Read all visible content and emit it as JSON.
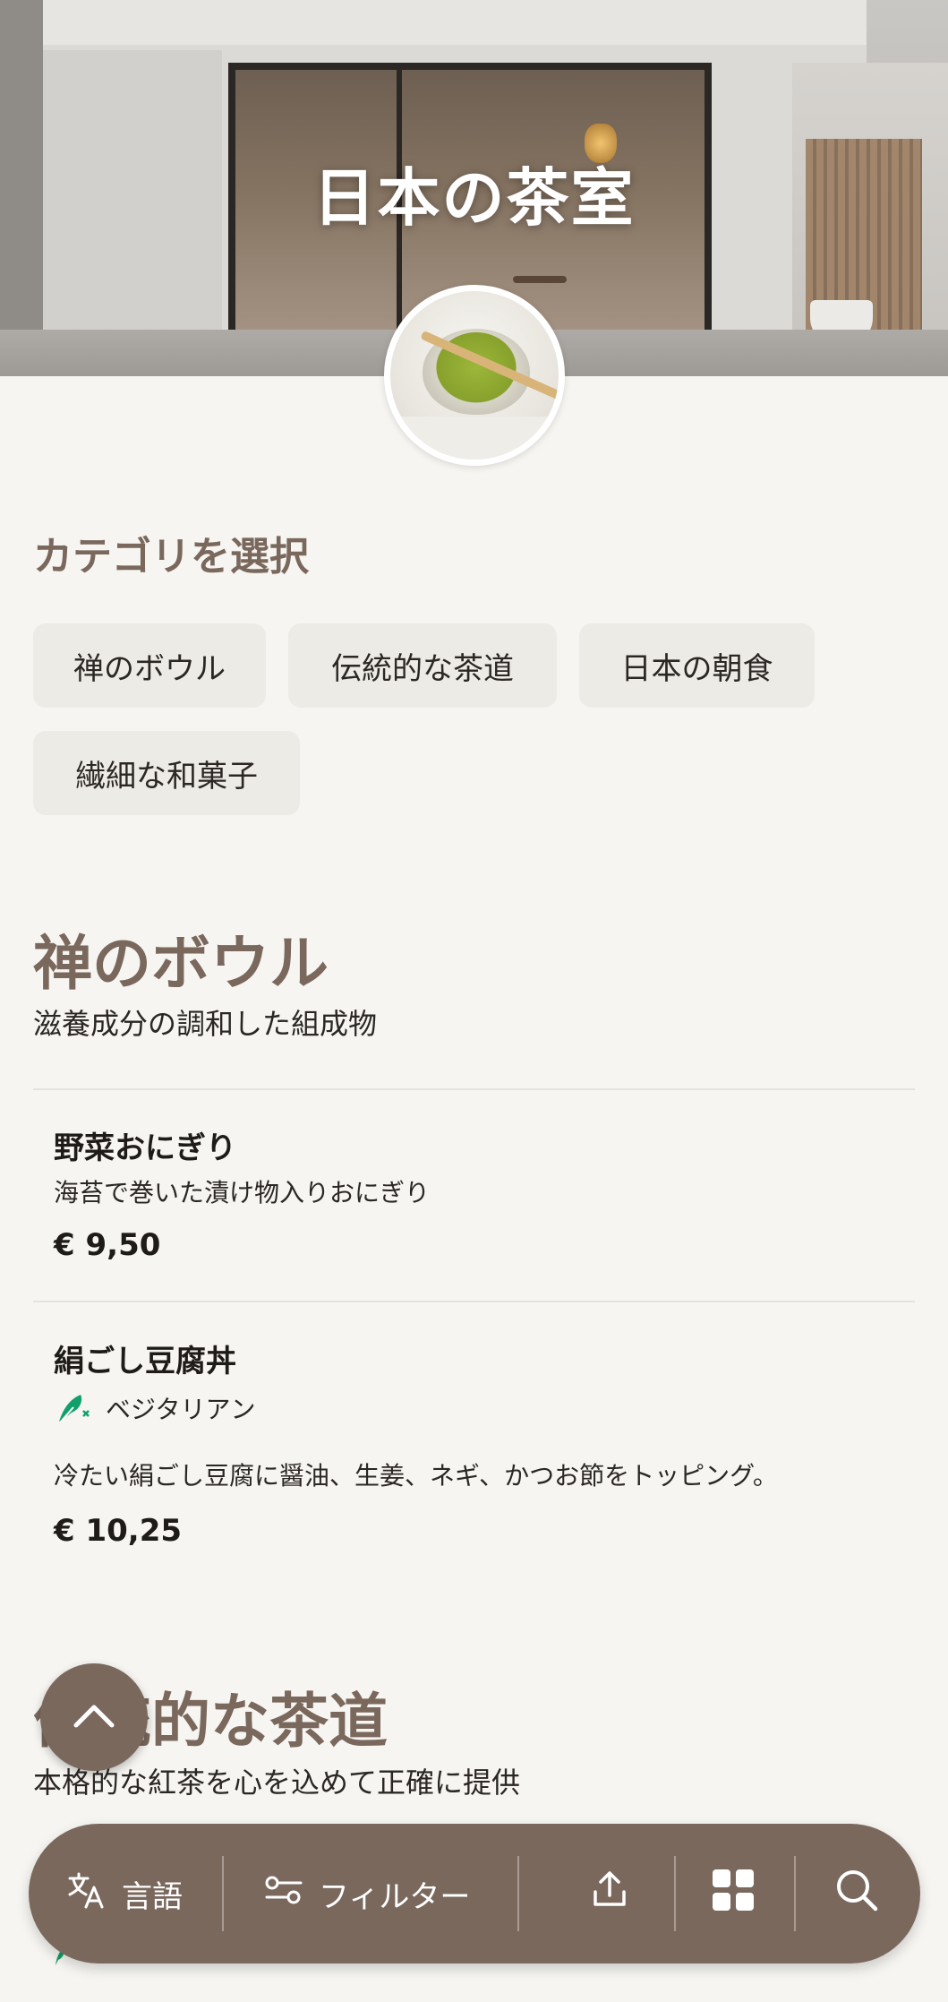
{
  "hero": {
    "title": "日本の茶室"
  },
  "categories": {
    "heading": "カテゴリを選択",
    "chips": [
      "禅のボウル",
      "伝統的な茶道",
      "日本の朝食",
      "繊細な和菓子"
    ]
  },
  "sections": [
    {
      "title": "禅のボウル",
      "subtitle": "滋養成分の調和した組成物",
      "items": [
        {
          "name": "野菜おにぎり",
          "description": "海苔で巻いた漬け物入りおにぎり",
          "price": "€ 9,50"
        },
        {
          "name": "絹ごし豆腐丼",
          "tag": "ベジタリアン",
          "tag_icon": "vegetarian-leaf-icon",
          "description": "冷たい絹ごし豆腐に醤油、生姜、ネギ、かつお節をトッピング。",
          "price": "€ 10,25"
        }
      ]
    },
    {
      "title": "伝統的な茶道",
      "subtitle": "本格的な紅茶を心を込めて正確に提供"
    }
  ],
  "bottom_bar": {
    "language_label": "言語",
    "filter_label": "フィルター",
    "icons": [
      "translate-icon",
      "filter-icon",
      "share-icon",
      "grid-icon",
      "search-icon"
    ]
  },
  "colors": {
    "accent": "#7a685d",
    "background": "#f6f5f1",
    "chip": "#edebe6",
    "vegetarian": "#12a06a"
  }
}
